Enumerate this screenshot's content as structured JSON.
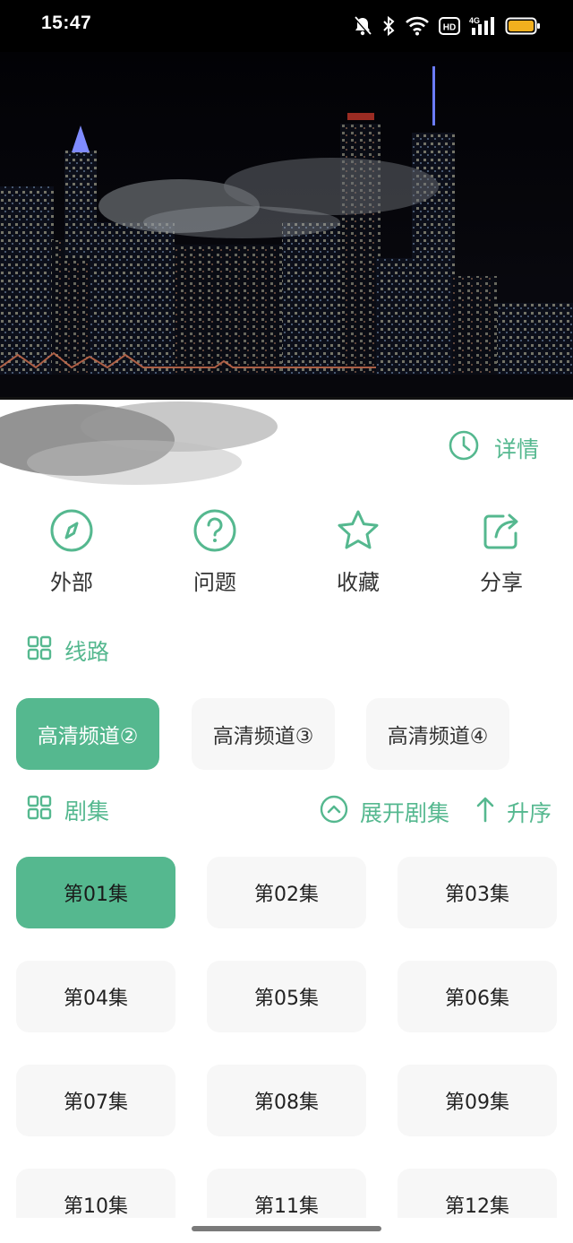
{
  "status_bar": {
    "time": "15:47",
    "icons": [
      "bell-off-icon",
      "bluetooth-icon",
      "wifi-icon",
      "hd-icon",
      "signal-4g-icon",
      "battery-icon"
    ],
    "hd_label": "HD",
    "network_label": "4G"
  },
  "colors": {
    "accent": "#55b88f",
    "chip_bg": "#f7f7f7",
    "text": "#333333"
  },
  "video": {
    "icon": "video-frame"
  },
  "title_row": {
    "details_label": "详情",
    "details_icon": "clock-icon"
  },
  "actions": [
    {
      "label": "外部",
      "icon": "compass-icon"
    },
    {
      "label": "问题",
      "icon": "question-icon"
    },
    {
      "label": "收藏",
      "icon": "star-icon"
    },
    {
      "label": "分享",
      "icon": "share-icon"
    }
  ],
  "routes": {
    "header": "线路",
    "icon": "grid-icon",
    "items": [
      {
        "label": "高清频道②",
        "active": true
      },
      {
        "label": "高清频道③",
        "active": false
      },
      {
        "label": "高清频道④",
        "active": false
      }
    ]
  },
  "episodes": {
    "header": "剧集",
    "icon": "grid-icon",
    "expand_label": "展开剧集",
    "expand_icon": "chevron-up-circle-icon",
    "sort_label": "升序",
    "sort_icon": "arrow-up-icon",
    "items": [
      {
        "label": "第01集",
        "active": true
      },
      {
        "label": "第02集",
        "active": false
      },
      {
        "label": "第03集",
        "active": false
      },
      {
        "label": "第04集",
        "active": false
      },
      {
        "label": "第05集",
        "active": false
      },
      {
        "label": "第06集",
        "active": false
      },
      {
        "label": "第07集",
        "active": false
      },
      {
        "label": "第08集",
        "active": false
      },
      {
        "label": "第09集",
        "active": false
      },
      {
        "label": "第10集",
        "active": false
      },
      {
        "label": "第11集",
        "active": false
      },
      {
        "label": "第12集",
        "active": false
      }
    ]
  }
}
